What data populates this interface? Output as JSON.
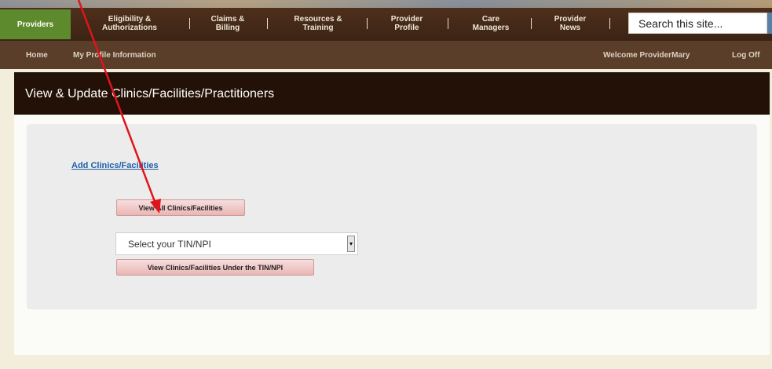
{
  "nav": {
    "items": [
      {
        "label": "Providers"
      },
      {
        "label": "Eligibility &\nAuthorizations"
      },
      {
        "label": "Claims &\nBilling"
      },
      {
        "label": "Resources &\nTraining"
      },
      {
        "label": "Provider\nProfile"
      },
      {
        "label": "Care\nManagers"
      },
      {
        "label": "Provider\nNews"
      }
    ],
    "search_placeholder": "Search this site..."
  },
  "subnav": {
    "home": "Home",
    "profile": "My Profile Information",
    "welcome": "Welcome ProviderMary",
    "logoff": "Log Off"
  },
  "page": {
    "title": "View & Update Clinics/Facilities/Practitioners",
    "add_link": "Add Clinics/Facilities",
    "view_all_button": "View All Clinics/Facilities",
    "select_value": "Select your TIN/NPI",
    "view_under_button": "View Clinics/Facilities Under the TIN/NPI"
  },
  "colors": {
    "accent_green": "#5d8a2c",
    "header_dark": "#231107",
    "annotation_arrow": "#e0141b"
  }
}
